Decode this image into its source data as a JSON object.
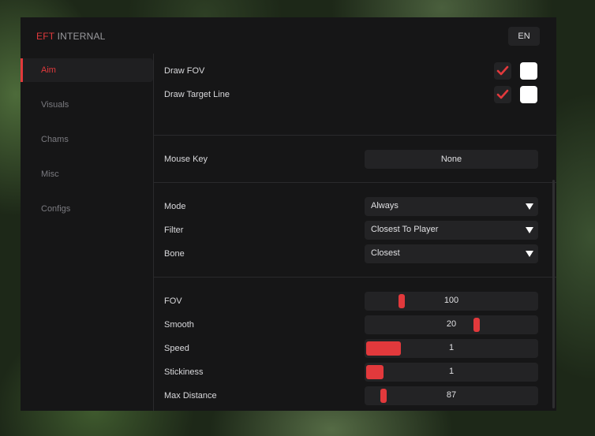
{
  "brand": {
    "accent": "EFT",
    "name": "INTERNAL"
  },
  "language": "EN",
  "colors": {
    "accent": "#e2393c",
    "panel": "#161617",
    "control": "#232325",
    "text": "#d9d9dc",
    "muted": "#7b7b80",
    "swatch": "#ffffff"
  },
  "sidebar": {
    "items": [
      {
        "label": "Aim",
        "active": true
      },
      {
        "label": "Visuals",
        "active": false
      },
      {
        "label": "Chams",
        "active": false
      },
      {
        "label": "Misc",
        "active": false
      },
      {
        "label": "Configs",
        "active": false
      }
    ]
  },
  "toggles": [
    {
      "label": "Draw FOV",
      "checked": true,
      "color": "#ffffff"
    },
    {
      "label": "Draw Target Line",
      "checked": true,
      "color": "#ffffff"
    }
  ],
  "mouse_key": {
    "label": "Mouse Key",
    "value": "None"
  },
  "selects": [
    {
      "label": "Mode",
      "value": "Always"
    },
    {
      "label": "Filter",
      "value": "Closest To Player"
    },
    {
      "label": "Bone",
      "value": "Closest"
    }
  ],
  "sliders": [
    {
      "label": "FOV",
      "value": "100"
    },
    {
      "label": "Smooth",
      "value": "20"
    },
    {
      "label": "Speed",
      "value": "1"
    },
    {
      "label": "Stickiness",
      "value": "1"
    },
    {
      "label": "Max Distance",
      "value": "87"
    }
  ]
}
